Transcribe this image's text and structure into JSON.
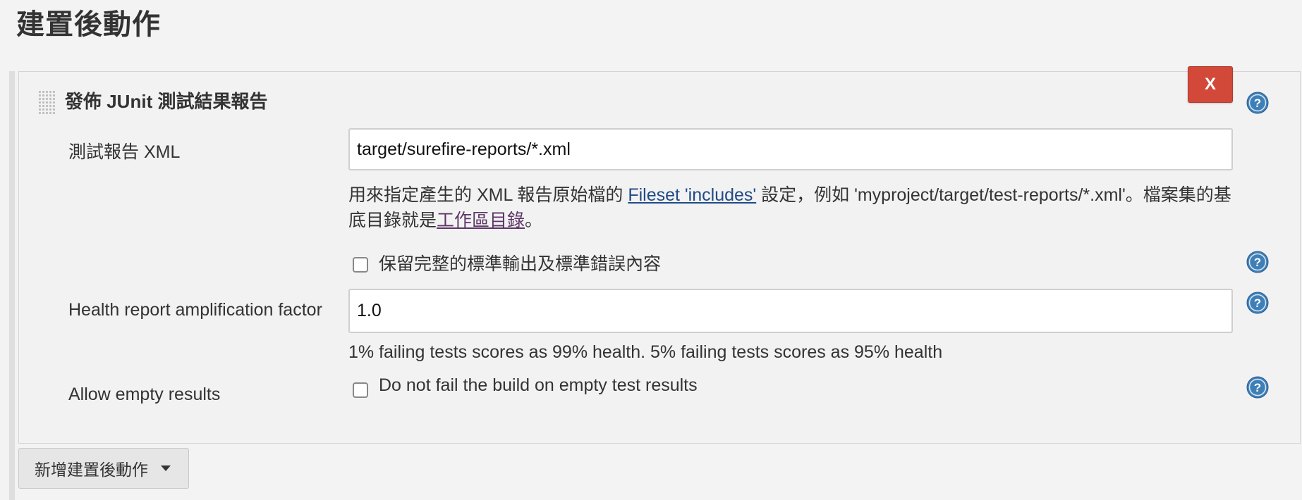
{
  "page": {
    "title": "建置後動作"
  },
  "publisher": {
    "title": "發佈 JUnit 測試結果報告",
    "delete_label": "X",
    "test_report": {
      "label": "測試報告 XML",
      "value": "target/surefire-reports/*.xml",
      "desc_before": "用來指定產生的 XML 報告原始檔的 ",
      "desc_link": "Fileset 'includes'",
      "desc_middle": " 設定，例如 'myproject/target/test-reports/*.xml'。檔案集的基底目錄就是",
      "desc_link2": "工作區目錄",
      "desc_after": "。"
    },
    "keep_output": {
      "label": "保留完整的標準輸出及標準錯誤內容",
      "checked": false
    },
    "health": {
      "label": "Health report amplification factor",
      "value": "1.0",
      "hint": "1% failing tests scores as 99% health. 5% failing tests scores as 95% health"
    },
    "allow_empty": {
      "label": "Allow empty results",
      "checkbox_label": "Do not fail the build on empty test results",
      "checked": false
    }
  },
  "add_action": {
    "label": "新增建置後動作"
  },
  "icons": {
    "help": "help-icon",
    "dropdown": "caret-down-icon",
    "drag": "drag-handle-icon"
  },
  "colors": {
    "delete": "#d24939",
    "help": "#3f7fb8",
    "link": "#204a87",
    "visited_link": "#5c3566"
  }
}
